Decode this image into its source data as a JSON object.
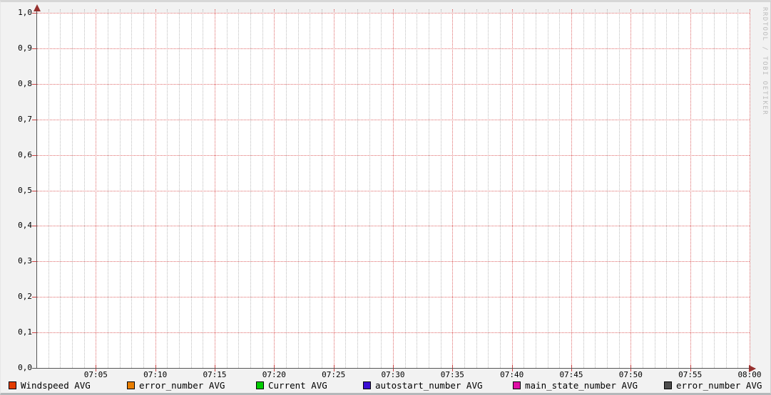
{
  "watermark": "RRDTOOL / TOBI OETIKER",
  "chart_data": {
    "type": "line",
    "title": "",
    "xlabel": "",
    "ylabel": "",
    "x_axis": {
      "range_start": "07:00",
      "range_end": "08:00",
      "tick_labels": [
        "07:05",
        "07:10",
        "07:15",
        "07:20",
        "07:25",
        "07:30",
        "07:35",
        "07:40",
        "07:45",
        "07:50",
        "07:55",
        "08:00"
      ],
      "minor_ticks_per_major": 5
    },
    "y_axis": {
      "min": 0.0,
      "max": 1.0,
      "step": 0.1,
      "tick_labels_top_to_bottom": [
        "1,0",
        "0,9",
        "0,8",
        "0,7",
        "0,6",
        "0,5",
        "0,4",
        "0,3",
        "0,2",
        "0,1",
        "0,0"
      ]
    },
    "grid": {
      "major_color": "#e06a6a",
      "minor_color": "#bdbdbd",
      "axis_color": "#555555",
      "arrow_color": "#96302e",
      "plot_background": "#ffffff",
      "outer_background": "#f2f2f2"
    },
    "legend": [
      {
        "label": "Windspeed AVG",
        "color": "#e23b00"
      },
      {
        "label": "error_number AVG",
        "color": "#e87e00"
      },
      {
        "label": "Current AVG",
        "color": "#00cc00"
      },
      {
        "label": "autostart_number AVG",
        "color": "#3a0dd4"
      },
      {
        "label": "main_state_number AVG",
        "color": "#df0da5"
      },
      {
        "label": "error_number AVG",
        "color": "#4d4d4d"
      }
    ],
    "series": [
      {
        "name": "Windspeed AVG",
        "values": []
      },
      {
        "name": "error_number AVG",
        "values": []
      },
      {
        "name": "Current AVG",
        "values": []
      },
      {
        "name": "autostart_number AVG",
        "values": []
      },
      {
        "name": "main_state_number AVG",
        "values": []
      },
      {
        "name": "error_number AVG",
        "values": []
      }
    ],
    "visible_data_points": "none"
  }
}
